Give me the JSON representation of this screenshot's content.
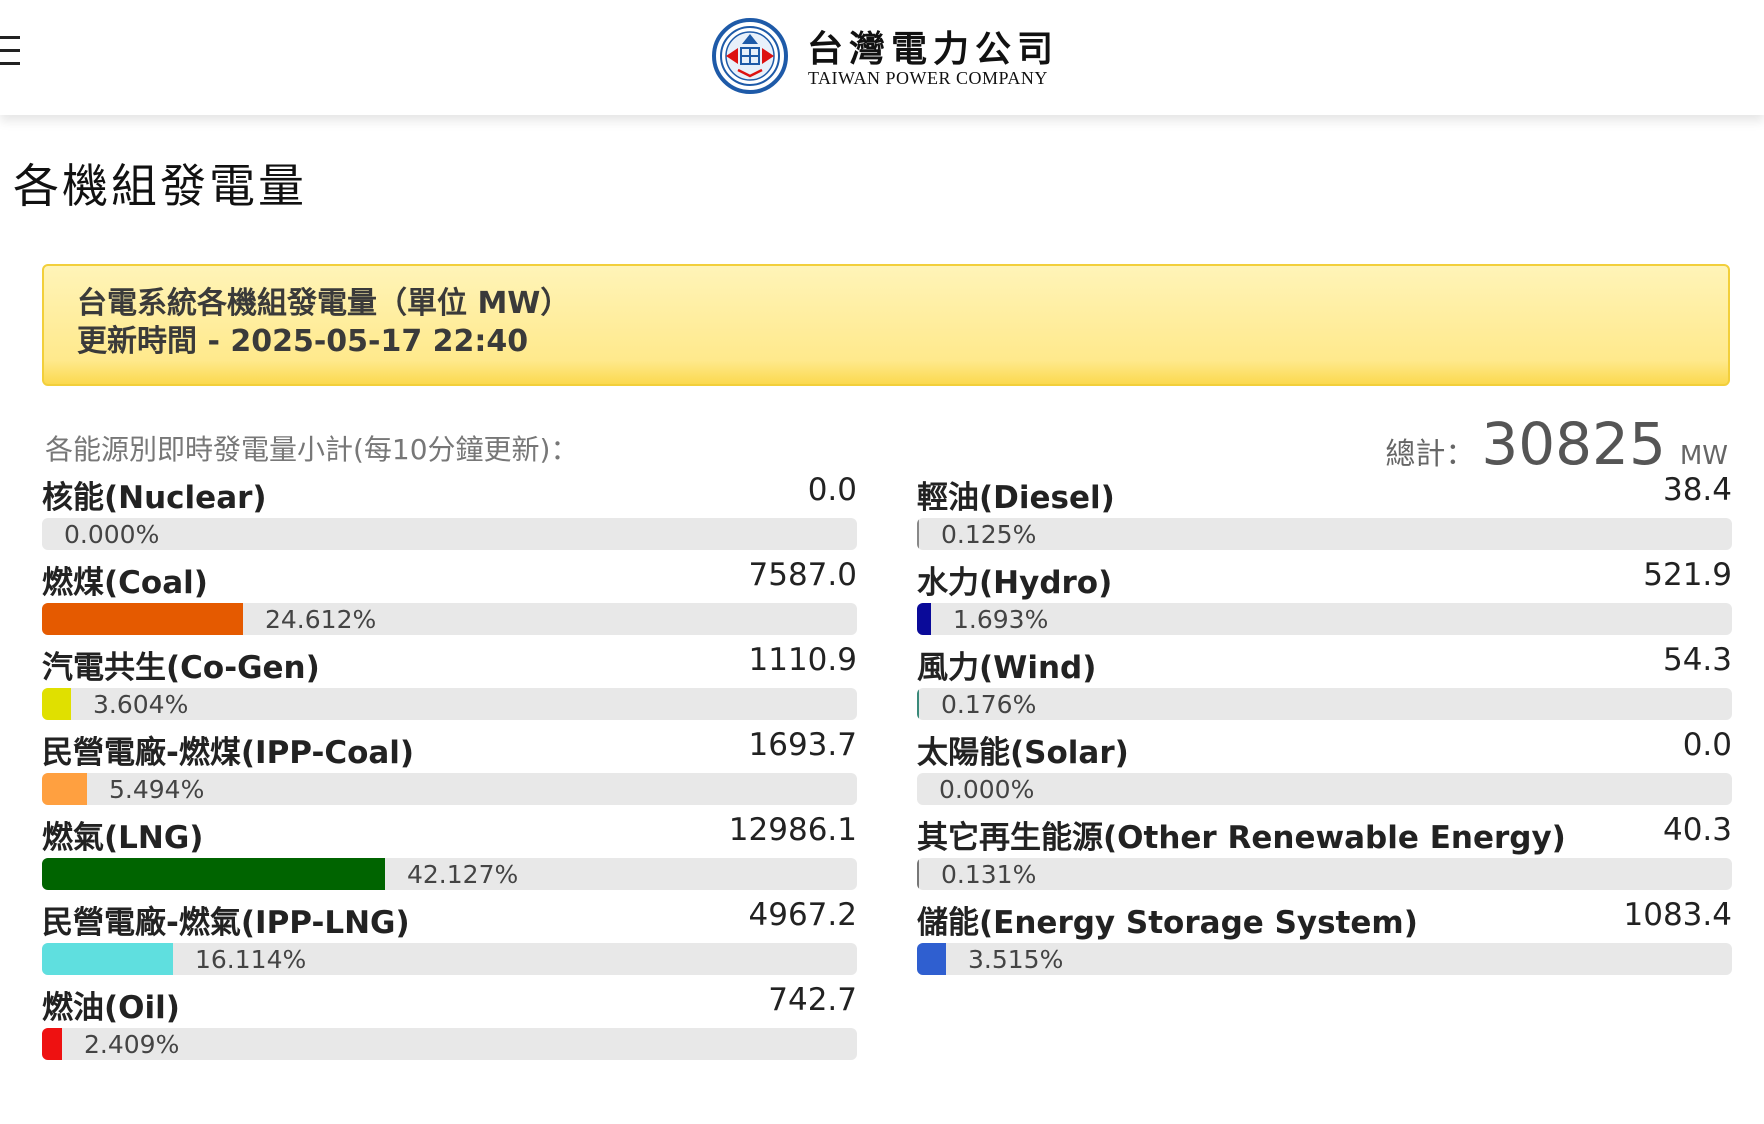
{
  "header": {
    "company_cn": "台灣電力公司",
    "company_en": "TAIWAN POWER COMPANY",
    "menu_icon": "hamburger-menu-icon",
    "logo_icon": "taipower-logo-icon"
  },
  "page_title": "各機組發電量",
  "banner": {
    "line1": "台電系統各機組發電量（單位 MW）",
    "line2": "更新時間 - 2025-05-17 22:40"
  },
  "subheading": "各能源別即時發電量小計(每10分鐘更新)：",
  "total": {
    "label": "總計：",
    "value": "30825",
    "unit": "MW"
  },
  "left_items": [
    {
      "name": "核能(Nuclear)",
      "value": "0.0",
      "pct": "0.000%",
      "fraction": 0.0,
      "color": "#cccccc"
    },
    {
      "name": "燃煤(Coal)",
      "value": "7587.0",
      "pct": "24.612%",
      "fraction": 0.24612,
      "color": "#e55a00"
    },
    {
      "name": "汽電共生(Co-Gen)",
      "value": "1110.9",
      "pct": "3.604%",
      "fraction": 0.03604,
      "color": "#e0e000"
    },
    {
      "name": "民營電廠-燃煤(IPP-Coal)",
      "value": "1693.7",
      "pct": "5.494%",
      "fraction": 0.05494,
      "color": "#ffa040"
    },
    {
      "name": "燃氣(LNG)",
      "value": "12986.1",
      "pct": "42.127%",
      "fraction": 0.42127,
      "color": "#006400"
    },
    {
      "name": "民營電廠-燃氣(IPP-LNG)",
      "value": "4967.2",
      "pct": "16.114%",
      "fraction": 0.16114,
      "color": "#5fdfdf"
    },
    {
      "name": "燃油(Oil)",
      "value": "742.7",
      "pct": "2.409%",
      "fraction": 0.02409,
      "color": "#ee1111"
    }
  ],
  "right_items": [
    {
      "name": "輕油(Diesel)",
      "value": "38.4",
      "pct": "0.125%",
      "fraction": 0.00125,
      "color": "#888888"
    },
    {
      "name": "水力(Hydro)",
      "value": "521.9",
      "pct": "1.693%",
      "fraction": 0.01693,
      "color": "#0a0a99"
    },
    {
      "name": "風力(Wind)",
      "value": "54.3",
      "pct": "0.176%",
      "fraction": 0.00176,
      "color": "#3a8a7a"
    },
    {
      "name": "太陽能(Solar)",
      "value": "0.0",
      "pct": "0.000%",
      "fraction": 0.0,
      "color": "#cccccc"
    },
    {
      "name": "其它再生能源(Other Renewable Energy)",
      "value": "40.3",
      "pct": "0.131%",
      "fraction": 0.00131,
      "color": "#777777"
    },
    {
      "name": "儲能(Energy Storage System)",
      "value": "1083.4",
      "pct": "3.515%",
      "fraction": 0.03515,
      "color": "#2f5fd0"
    }
  ]
}
